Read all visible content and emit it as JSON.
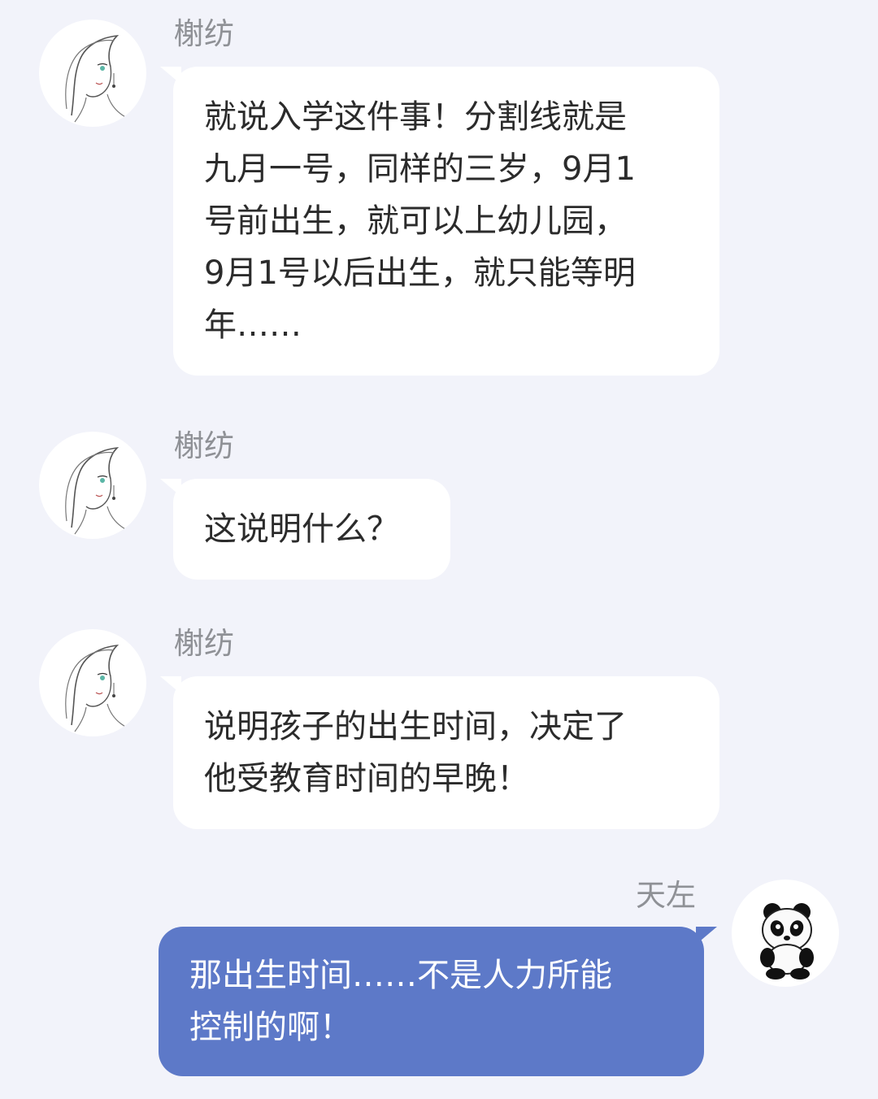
{
  "messages": [
    {
      "sender": "榭纺",
      "side": "incoming",
      "avatar_icon": "woman-sketch-avatar-icon",
      "text": "就说入学这件事！分割线就是\n九月一号，同样的三岁，9月1\n号前出生，就可以上幼儿园，\n9月1号以后出生，就只能等明\n年……"
    },
    {
      "sender": "榭纺",
      "side": "incoming",
      "avatar_icon": "woman-sketch-avatar-icon",
      "text": "这说明什么？"
    },
    {
      "sender": "榭纺",
      "side": "incoming",
      "avatar_icon": "woman-sketch-avatar-icon",
      "text": "说明孩子的出生时间，决定了\n他受教育时间的早晚！"
    },
    {
      "sender": "天左",
      "side": "outgoing",
      "avatar_icon": "panda-avatar-icon",
      "text": "那出生时间……不是人力所能\n控制的啊！"
    }
  ],
  "colors": {
    "background": "#f2f3fa",
    "incoming_bubble": "#ffffff",
    "outgoing_bubble": "#5d79c8",
    "sender_name": "#8f9196"
  }
}
